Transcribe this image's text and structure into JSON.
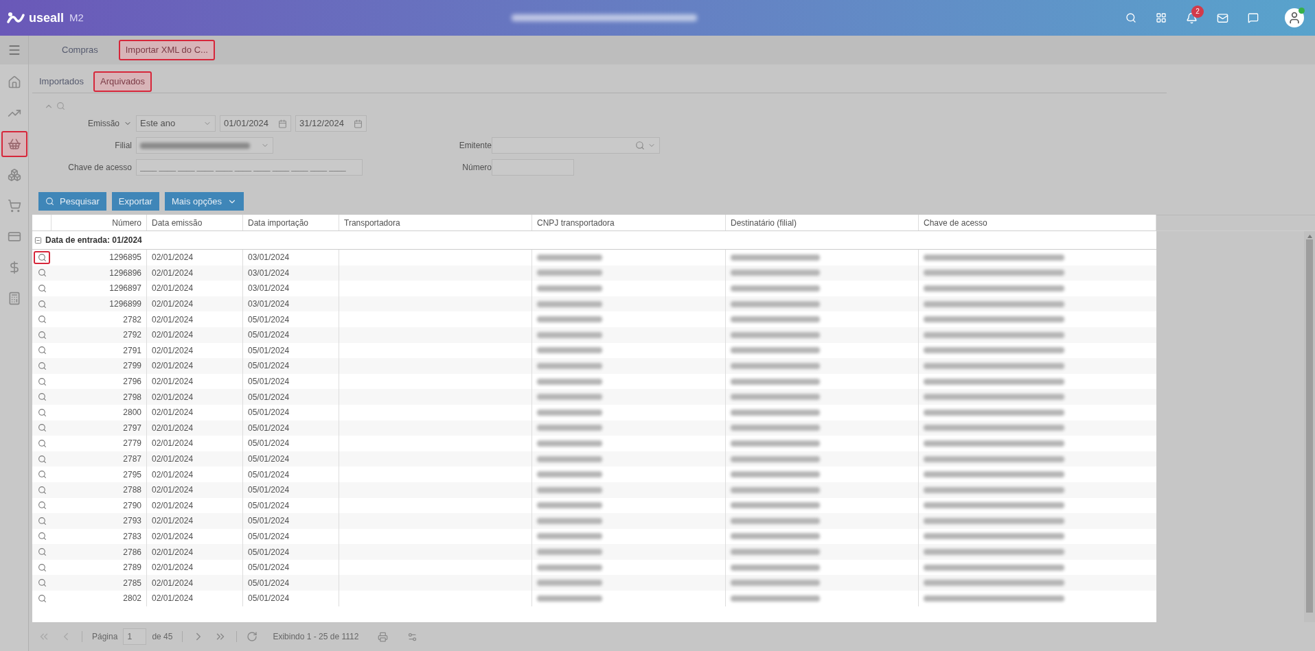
{
  "header": {
    "logo": "useall",
    "logo_suffix": "M2",
    "notification_count": "2"
  },
  "sidebar": {
    "items": [
      {
        "selected": false
      },
      {
        "selected": false
      },
      {
        "selected": true
      },
      {
        "selected": false
      },
      {
        "selected": false
      },
      {
        "selected": false
      },
      {
        "selected": false
      },
      {
        "selected": false
      }
    ]
  },
  "module_tabs": [
    {
      "label": "Compras",
      "selected": false
    },
    {
      "label": "Importar XML do C...",
      "selected": true
    }
  ],
  "sub_tabs": [
    {
      "label": "Importados",
      "selected": false
    },
    {
      "label": "Arquivados",
      "selected": true
    }
  ],
  "filters": {
    "emissao_label": "Emissão",
    "period": "Este ano",
    "date_from": "01/01/2024",
    "date_to": "31/12/2024",
    "filial_label": "Filial",
    "emitente_label": "Emitente",
    "chave_label": "Chave de acesso",
    "chave_placeholder": "____ ____ ____ ____ ____ ____ ____ ____ ____ ____ ____",
    "numero_label": "Número"
  },
  "buttons": [
    {
      "label": "Pesquisar",
      "kind": "search"
    },
    {
      "label": "Exportar",
      "kind": "plain"
    },
    {
      "label": "Mais opções",
      "kind": "dropdown"
    }
  ],
  "table": {
    "columns": [
      "Número",
      "Data emissão",
      "Data importação",
      "Transportadora",
      "CNPJ transportadora",
      "Destinatário (filial)",
      "Chave de acesso"
    ],
    "group": "Data de entrada: 01/2024",
    "rows": [
      {
        "numero": "1296895",
        "emissao": "02/01/2024",
        "importacao": "03/01/2024",
        "selected": true
      },
      {
        "numero": "1296896",
        "emissao": "02/01/2024",
        "importacao": "03/01/2024",
        "selected": false
      },
      {
        "numero": "1296897",
        "emissao": "02/01/2024",
        "importacao": "03/01/2024",
        "selected": false
      },
      {
        "numero": "1296899",
        "emissao": "02/01/2024",
        "importacao": "03/01/2024",
        "selected": false
      },
      {
        "numero": "2782",
        "emissao": "02/01/2024",
        "importacao": "05/01/2024",
        "selected": false
      },
      {
        "numero": "2792",
        "emissao": "02/01/2024",
        "importacao": "05/01/2024",
        "selected": false
      },
      {
        "numero": "2791",
        "emissao": "02/01/2024",
        "importacao": "05/01/2024",
        "selected": false
      },
      {
        "numero": "2799",
        "emissao": "02/01/2024",
        "importacao": "05/01/2024",
        "selected": false
      },
      {
        "numero": "2796",
        "emissao": "02/01/2024",
        "importacao": "05/01/2024",
        "selected": false
      },
      {
        "numero": "2798",
        "emissao": "02/01/2024",
        "importacao": "05/01/2024",
        "selected": false
      },
      {
        "numero": "2800",
        "emissao": "02/01/2024",
        "importacao": "05/01/2024",
        "selected": false
      },
      {
        "numero": "2797",
        "emissao": "02/01/2024",
        "importacao": "05/01/2024",
        "selected": false
      },
      {
        "numero": "2779",
        "emissao": "02/01/2024",
        "importacao": "05/01/2024",
        "selected": false
      },
      {
        "numero": "2787",
        "emissao": "02/01/2024",
        "importacao": "05/01/2024",
        "selected": false
      },
      {
        "numero": "2795",
        "emissao": "02/01/2024",
        "importacao": "05/01/2024",
        "selected": false
      },
      {
        "numero": "2788",
        "emissao": "02/01/2024",
        "importacao": "05/01/2024",
        "selected": false
      },
      {
        "numero": "2790",
        "emissao": "02/01/2024",
        "importacao": "05/01/2024",
        "selected": false
      },
      {
        "numero": "2793",
        "emissao": "02/01/2024",
        "importacao": "05/01/2024",
        "selected": false
      },
      {
        "numero": "2783",
        "emissao": "02/01/2024",
        "importacao": "05/01/2024",
        "selected": false
      },
      {
        "numero": "2786",
        "emissao": "02/01/2024",
        "importacao": "05/01/2024",
        "selected": false
      },
      {
        "numero": "2789",
        "emissao": "02/01/2024",
        "importacao": "05/01/2024",
        "selected": false
      },
      {
        "numero": "2785",
        "emissao": "02/01/2024",
        "importacao": "05/01/2024",
        "selected": false
      },
      {
        "numero": "2802",
        "emissao": "02/01/2024",
        "importacao": "05/01/2024",
        "selected": false
      }
    ]
  },
  "pager": {
    "page_label": "Página",
    "page": "1",
    "page_total": "de 45",
    "summary": "Exibindo 1 - 25 de 1112"
  }
}
